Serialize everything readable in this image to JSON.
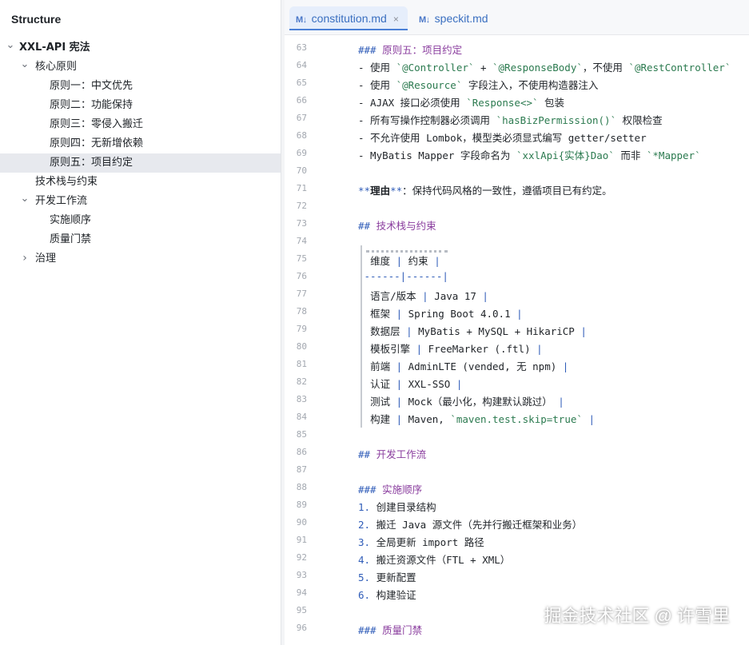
{
  "structure": {
    "title": "Structure",
    "items": [
      {
        "label": "XXL-API 宪法",
        "level": 0,
        "chevron": "down",
        "selected": false
      },
      {
        "label": "核心原则",
        "level": 1,
        "chevron": "down",
        "selected": false
      },
      {
        "label": "原则一：中文优先",
        "level": 2,
        "chevron": "",
        "selected": false
      },
      {
        "label": "原则二：功能保持",
        "level": 2,
        "chevron": "",
        "selected": false
      },
      {
        "label": "原则三：零侵入搬迁",
        "level": 2,
        "chevron": "",
        "selected": false
      },
      {
        "label": "原则四：无新增依赖",
        "level": 2,
        "chevron": "",
        "selected": false
      },
      {
        "label": "原则五：项目约定",
        "level": 2,
        "chevron": "",
        "selected": true
      },
      {
        "label": "技术栈与约束",
        "level": 1,
        "chevron": "",
        "selected": false
      },
      {
        "label": "开发工作流",
        "level": 1,
        "chevron": "down",
        "selected": false
      },
      {
        "label": "实施顺序",
        "level": 2,
        "chevron": "",
        "selected": false
      },
      {
        "label": "质量门禁",
        "level": 2,
        "chevron": "",
        "selected": false
      },
      {
        "label": "治理",
        "level": 1,
        "chevron": "right",
        "selected": false
      }
    ]
  },
  "tabs": [
    {
      "icon": "M↓",
      "label": "constitution.md",
      "active": true,
      "close": "×"
    },
    {
      "icon": "M↓",
      "label": "speckit.md",
      "active": false,
      "close": ""
    }
  ],
  "editor": {
    "lines": [
      {
        "n": "63",
        "segs": [
          {
            "t": "### ",
            "c": "t-h"
          },
          {
            "t": "原则五：项目约定",
            "c": "t-ht"
          }
        ]
      },
      {
        "n": "64",
        "segs": [
          {
            "t": "- 使用 "
          },
          {
            "t": "`@Controller`",
            "c": "t-code"
          },
          {
            "t": " + "
          },
          {
            "t": "`@ResponseBody`",
            "c": "t-code"
          },
          {
            "t": "，不使用 "
          },
          {
            "t": "`@RestController`",
            "c": "t-code"
          }
        ]
      },
      {
        "n": "65",
        "segs": [
          {
            "t": "- 使用 "
          },
          {
            "t": "`@Resource`",
            "c": "t-code"
          },
          {
            "t": " 字段注入，不使用构造器注入"
          }
        ]
      },
      {
        "n": "66",
        "segs": [
          {
            "t": "- AJAX 接口必须使用 "
          },
          {
            "t": "`Response<>`",
            "c": "t-code"
          },
          {
            "t": " 包装"
          }
        ]
      },
      {
        "n": "67",
        "segs": [
          {
            "t": "- 所有写操作控制器必须调用 "
          },
          {
            "t": "`hasBizPermission()`",
            "c": "t-code"
          },
          {
            "t": " 权限检查"
          }
        ]
      },
      {
        "n": "68",
        "segs": [
          {
            "t": "- 不允许使用 Lombok，模型类必须显式编写 getter/setter"
          }
        ]
      },
      {
        "n": "69",
        "segs": [
          {
            "t": "- MyBatis Mapper 字段命名为 "
          },
          {
            "t": "`xxlApi{实体}Dao`",
            "c": "t-code"
          },
          {
            "t": " 而非 "
          },
          {
            "t": "`*Mapper`",
            "c": "t-code"
          }
        ]
      },
      {
        "n": "70",
        "segs": []
      },
      {
        "n": "71",
        "segs": [
          {
            "t": "**",
            "c": "t-h"
          },
          {
            "t": "理由",
            "c": "t-bold"
          },
          {
            "t": "**",
            "c": "t-h"
          },
          {
            "t": "：保持代码风格的一致性，遵循项目已有约定。"
          }
        ]
      },
      {
        "n": "72",
        "segs": []
      },
      {
        "n": "73",
        "segs": [
          {
            "t": "## ",
            "c": "t-h"
          },
          {
            "t": "技术栈与约束",
            "c": "t-ht"
          }
        ]
      },
      {
        "n": "74",
        "segs": []
      },
      {
        "n": "75",
        "segs": [
          {
            "t": "| ",
            "c": "t-pipe"
          },
          {
            "t": "维度 "
          },
          {
            "t": "| ",
            "c": "t-pipe"
          },
          {
            "t": "约束 "
          },
          {
            "t": "|",
            "c": "t-pipe"
          }
        ]
      },
      {
        "n": "76",
        "segs": [
          {
            "t": "|------|------|",
            "c": "t-pipe"
          }
        ]
      },
      {
        "n": "77",
        "segs": [
          {
            "t": "| ",
            "c": "t-pipe"
          },
          {
            "t": "语言/版本 "
          },
          {
            "t": "| ",
            "c": "t-pipe"
          },
          {
            "t": "Java 17 "
          },
          {
            "t": "|",
            "c": "t-pipe"
          }
        ]
      },
      {
        "n": "78",
        "segs": [
          {
            "t": "| ",
            "c": "t-pipe"
          },
          {
            "t": "框架 "
          },
          {
            "t": "| ",
            "c": "t-pipe"
          },
          {
            "t": "Spring Boot 4.0.1 "
          },
          {
            "t": "|",
            "c": "t-pipe"
          }
        ]
      },
      {
        "n": "79",
        "segs": [
          {
            "t": "| ",
            "c": "t-pipe"
          },
          {
            "t": "数据层 "
          },
          {
            "t": "| ",
            "c": "t-pipe"
          },
          {
            "t": "MyBatis + MySQL + HikariCP "
          },
          {
            "t": "|",
            "c": "t-pipe"
          }
        ]
      },
      {
        "n": "80",
        "segs": [
          {
            "t": "| ",
            "c": "t-pipe"
          },
          {
            "t": "模板引擎 "
          },
          {
            "t": "| ",
            "c": "t-pipe"
          },
          {
            "t": "FreeMarker (.ftl) "
          },
          {
            "t": "|",
            "c": "t-pipe"
          }
        ]
      },
      {
        "n": "81",
        "segs": [
          {
            "t": "| ",
            "c": "t-pipe"
          },
          {
            "t": "前端 "
          },
          {
            "t": "| ",
            "c": "t-pipe"
          },
          {
            "t": "AdminLTE (vended, 无 npm) "
          },
          {
            "t": "|",
            "c": "t-pipe"
          }
        ]
      },
      {
        "n": "82",
        "segs": [
          {
            "t": "| ",
            "c": "t-pipe"
          },
          {
            "t": "认证 "
          },
          {
            "t": "| ",
            "c": "t-pipe"
          },
          {
            "t": "XXL-SSO "
          },
          {
            "t": "|",
            "c": "t-pipe"
          }
        ]
      },
      {
        "n": "83",
        "segs": [
          {
            "t": "| ",
            "c": "t-pipe"
          },
          {
            "t": "测试 "
          },
          {
            "t": "| ",
            "c": "t-pipe"
          },
          {
            "t": "Mock（最小化，构建默认跳过） "
          },
          {
            "t": "|",
            "c": "t-pipe"
          }
        ]
      },
      {
        "n": "84",
        "segs": [
          {
            "t": "| ",
            "c": "t-pipe"
          },
          {
            "t": "构建 "
          },
          {
            "t": "| ",
            "c": "t-pipe"
          },
          {
            "t": "Maven, "
          },
          {
            "t": "`maven.test.skip=true`",
            "c": "t-code"
          },
          {
            "t": " "
          },
          {
            "t": "|",
            "c": "t-pipe"
          }
        ]
      },
      {
        "n": "85",
        "segs": []
      },
      {
        "n": "86",
        "segs": [
          {
            "t": "## ",
            "c": "t-h"
          },
          {
            "t": "开发工作流",
            "c": "t-ht"
          }
        ]
      },
      {
        "n": "87",
        "segs": []
      },
      {
        "n": "88",
        "segs": [
          {
            "t": "### ",
            "c": "t-h"
          },
          {
            "t": "实施顺序",
            "c": "t-ht"
          }
        ]
      },
      {
        "n": "89",
        "segs": [
          {
            "t": "1. ",
            "c": "t-num"
          },
          {
            "t": "创建目录结构"
          }
        ]
      },
      {
        "n": "90",
        "segs": [
          {
            "t": "2. ",
            "c": "t-num"
          },
          {
            "t": "搬迁 Java 源文件（先并行搬迁框架和业务）"
          }
        ]
      },
      {
        "n": "91",
        "segs": [
          {
            "t": "3. ",
            "c": "t-num"
          },
          {
            "t": "全局更新 import 路径"
          }
        ]
      },
      {
        "n": "92",
        "segs": [
          {
            "t": "4. ",
            "c": "t-num"
          },
          {
            "t": "搬迁资源文件（FTL + XML）"
          }
        ]
      },
      {
        "n": "93",
        "segs": [
          {
            "t": "5. ",
            "c": "t-num"
          },
          {
            "t": "更新配置"
          }
        ]
      },
      {
        "n": "94",
        "segs": [
          {
            "t": "6. ",
            "c": "t-num"
          },
          {
            "t": "构建验证"
          }
        ]
      },
      {
        "n": "95",
        "segs": []
      },
      {
        "n": "96",
        "segs": [
          {
            "t": "### ",
            "c": "t-h"
          },
          {
            "t": "质量门禁",
            "c": "t-ht"
          }
        ]
      }
    ]
  },
  "watermark": "掘金技术社区 @ 许雪里"
}
